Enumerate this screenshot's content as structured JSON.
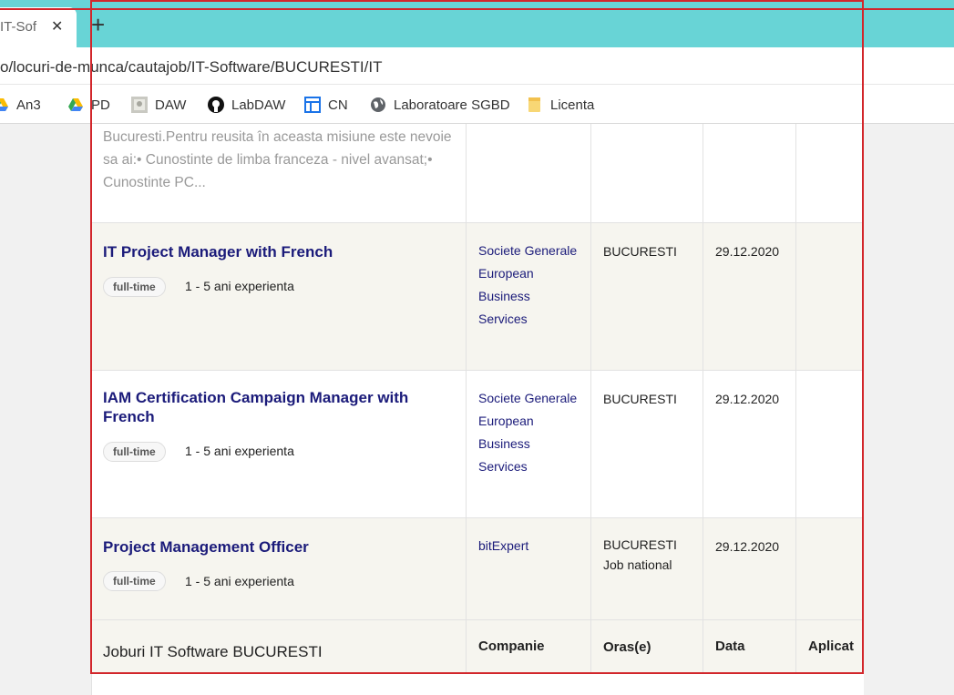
{
  "browser": {
    "tab_title": "IT-Sof",
    "tab_close": "✕",
    "new_tab": "+",
    "url": "o/locuri-de-munca/cautajob/IT-Software/BUCURESTI/IT",
    "bookmarks": [
      {
        "label": "An3",
        "icon": "google-drive-icon"
      },
      {
        "label": "PD",
        "icon": "google-drive-icon"
      },
      {
        "label": "DAW",
        "icon": "image-thumbnail-icon"
      },
      {
        "label": "LabDAW",
        "icon": "github-icon"
      },
      {
        "label": "CN",
        "icon": "layout-icon"
      },
      {
        "label": "Laboratoare SGBD",
        "icon": "globe-icon"
      },
      {
        "label": "Licenta",
        "icon": "folder-icon"
      }
    ]
  },
  "listing": {
    "partial_description": "se alatura echipei Suport Tehnic de la sediul nostru din Bucuresti.Pentru reusita în aceasta misiune este nevoie sa ai:• Cunostinte de limba franceza - nivel avansat;• Cunostinte PC...",
    "jobs": [
      {
        "title": "IT Project Manager with French",
        "type": "full-time",
        "experience": "1 - 5 ani experienta",
        "company": "Societe Generale European Business Services",
        "city": "BUCURESTI",
        "city_extra": "",
        "date": "29.12.2020"
      },
      {
        "title": "IAM Certification Campaign Manager with French",
        "type": "full-time",
        "experience": "1 - 5 ani experienta",
        "company": "Societe Generale European Business Services",
        "city": "BUCURESTI",
        "city_extra": "",
        "date": "29.12.2020"
      },
      {
        "title": "Project Management Officer",
        "type": "full-time",
        "experience": "1 - 5 ani experienta",
        "company": "bitExpert",
        "city": "BUCURESTI",
        "city_extra": "Job national",
        "date": "29.12.2020"
      }
    ],
    "footer": {
      "title": "Joburi IT Software BUCURESTI",
      "col_company": "Companie",
      "col_city": "Oras(e)",
      "col_date": "Data",
      "col_apply": "Aplicat"
    }
  },
  "colors": {
    "tabstrip": "#68d4d6",
    "job_title": "#1b1b7a",
    "annotation_box": "#d2262b"
  }
}
